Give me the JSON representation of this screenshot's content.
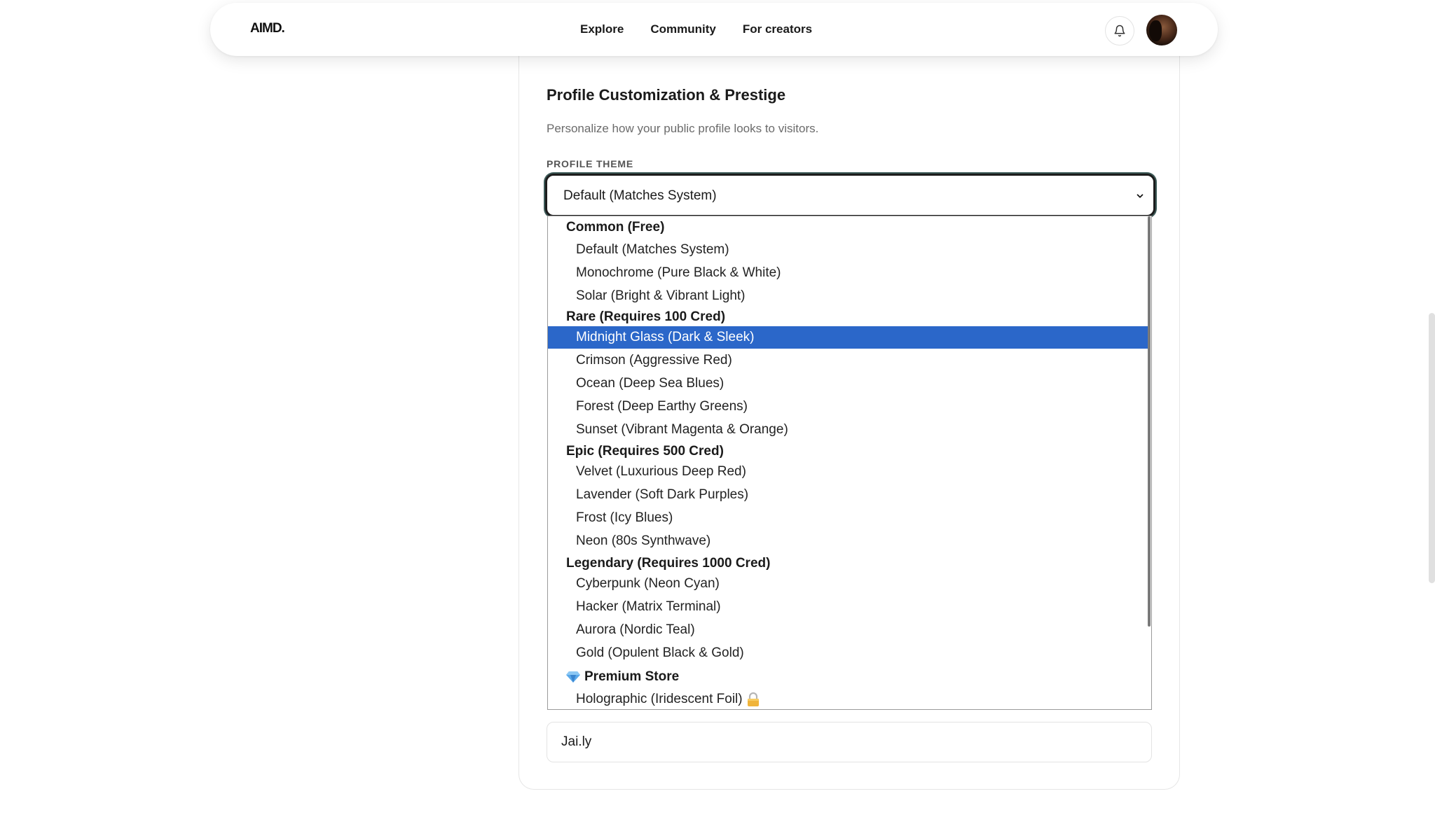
{
  "header": {
    "logo": "AIMD.",
    "nav": [
      "Explore",
      "Community",
      "For creators"
    ]
  },
  "section": {
    "title": "Profile Customization & Prestige",
    "subtitle": "Personalize how your public profile looks to visitors."
  },
  "profile_theme": {
    "label": "PROFILE THEME",
    "selected_value": "Default (Matches System)",
    "highlighted_option": "Midnight Glass (Dark & Sleek)",
    "groups": [
      {
        "label": "Common (Free)",
        "options": [
          "Default (Matches System)",
          "Monochrome (Pure Black & White)",
          "Solar (Bright & Vibrant Light)"
        ]
      },
      {
        "label": "Rare (Requires 100 Cred)",
        "options": [
          "Midnight Glass (Dark & Sleek)",
          "Crimson (Aggressive Red)",
          "Ocean (Deep Sea Blues)",
          "Forest (Deep Earthy Greens)",
          "Sunset (Vibrant Magenta & Orange)"
        ]
      },
      {
        "label": "Epic (Requires 500 Cred)",
        "options": [
          "Velvet (Luxurious Deep Red)",
          "Lavender (Soft Dark Purples)",
          "Frost (Icy Blues)",
          "Neon (80s Synthwave)"
        ]
      },
      {
        "label": "Legendary (Requires 1000 Cred)",
        "options": [
          "Cyberpunk (Neon Cyan)",
          "Hacker (Matrix Terminal)",
          "Aurora (Nordic Teal)",
          "Gold (Opulent Black & Gold)"
        ]
      },
      {
        "label": "Premium Store",
        "icon": "gem-icon",
        "options": [
          "Holographic (Iridescent Foil)"
        ],
        "option_icon": "lock-icon"
      }
    ]
  },
  "next_field": {
    "value": "Jai.ly"
  },
  "colors": {
    "highlight": "#2b67c9",
    "focus_ring": "#1c1c1c",
    "muted_text": "#6b6b6b"
  }
}
